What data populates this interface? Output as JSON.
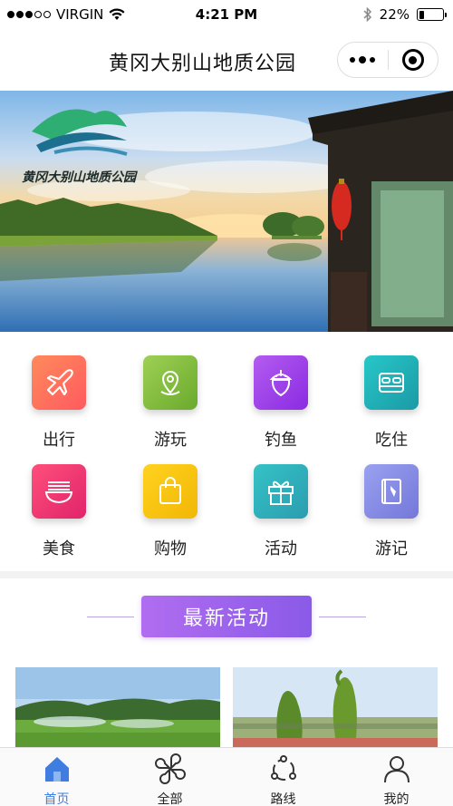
{
  "status_bar": {
    "carrier": "VIRGIN",
    "time": "4:21 PM",
    "battery": "22%",
    "battery_level": 0.22
  },
  "nav": {
    "title": "黄冈大别山地质公园"
  },
  "banner": {
    "logo_text": "黄冈大别山地质公园"
  },
  "grid": [
    {
      "label": "出行",
      "icon": "airplane-icon",
      "colors": [
        "#ff8a5b",
        "#ff5a5f"
      ]
    },
    {
      "label": "游玩",
      "icon": "map-pin-icon",
      "colors": [
        "#9ed054",
        "#6aaa2c"
      ]
    },
    {
      "label": "钓鱼",
      "icon": "acorn-icon",
      "colors": [
        "#b45cf0",
        "#8a2be2"
      ]
    },
    {
      "label": "吃住",
      "icon": "bed-icon",
      "colors": [
        "#27c7c8",
        "#1b9aa6"
      ]
    },
    {
      "label": "美食",
      "icon": "noodle-bowl-icon",
      "colors": [
        "#ff4f7b",
        "#e0246a"
      ]
    },
    {
      "label": "购物",
      "icon": "shopping-bag-icon",
      "colors": [
        "#ffd21f",
        "#f2b705"
      ]
    },
    {
      "label": "活动",
      "icon": "gift-icon",
      "colors": [
        "#35c2c6",
        "#2a9db0"
      ]
    },
    {
      "label": "游记",
      "icon": "notebook-icon",
      "colors": [
        "#9aa1f0",
        "#7477d9"
      ]
    }
  ],
  "section": {
    "title": "最新活动"
  },
  "tabs": [
    {
      "label": "首页",
      "icon": "home-icon"
    },
    {
      "label": "全部",
      "icon": "grid-petals-icon"
    },
    {
      "label": "路线",
      "icon": "route-icon"
    },
    {
      "label": "我的",
      "icon": "user-icon"
    }
  ]
}
